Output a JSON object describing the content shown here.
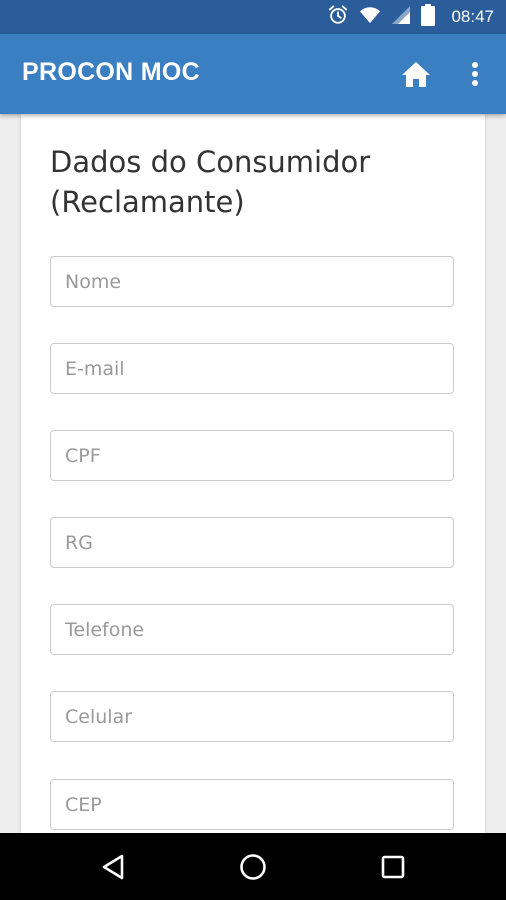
{
  "status_bar": {
    "time": "08:47",
    "icons": [
      "alarm-icon",
      "wifi-icon",
      "signal-icon",
      "battery-icon"
    ]
  },
  "app_bar": {
    "title": "PROCON MOC",
    "actions": [
      "home-icon",
      "more-vert-icon"
    ]
  },
  "form": {
    "title": "Dados do Consumidor (Reclamante)",
    "fields": [
      {
        "placeholder": "Nome",
        "value": ""
      },
      {
        "placeholder": "E-mail",
        "value": ""
      },
      {
        "placeholder": "CPF",
        "value": ""
      },
      {
        "placeholder": "RG",
        "value": ""
      },
      {
        "placeholder": "Telefone",
        "value": ""
      },
      {
        "placeholder": "Celular",
        "value": ""
      },
      {
        "placeholder": "CEP",
        "value": ""
      }
    ]
  },
  "nav_bar": {
    "buttons": [
      "back-icon",
      "home-circle-icon",
      "recents-icon"
    ]
  },
  "colors": {
    "status_bar": "#2a5d99",
    "app_bar": "#3a7fc1",
    "background": "#eeeeee",
    "card": "#ffffff",
    "field_border": "#cccccc",
    "placeholder_text": "#9a9a9a",
    "nav_bar": "#000000"
  }
}
